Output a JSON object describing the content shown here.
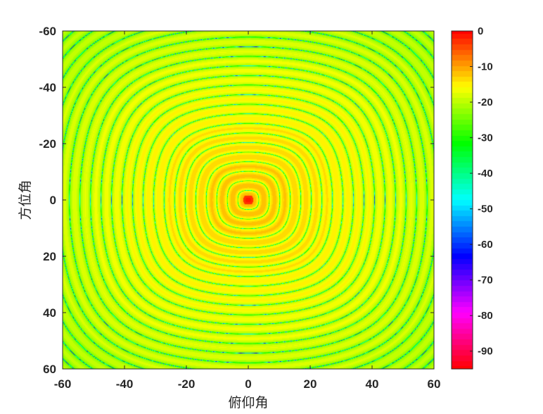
{
  "chart_data": {
    "type": "heatmap",
    "title": "",
    "xlabel": "俯仰角",
    "ylabel": "方位角",
    "x_ticks": [
      "-60",
      "-40",
      "-20",
      "0",
      "20",
      "40",
      "60"
    ],
    "y_ticks": [
      "-60",
      "-40",
      "-20",
      "0",
      "20",
      "40",
      "60"
    ],
    "xlim": [
      -60,
      60
    ],
    "ylim": [
      -60,
      60
    ],
    "y_direction": "reversed",
    "colorbar": {
      "range": [
        -95,
        0
      ],
      "ticks": [
        "0",
        "-10",
        "-20",
        "-30",
        "-40",
        "-50",
        "-60",
        "-70",
        "-80",
        "-90"
      ],
      "colormap": "hsv"
    },
    "pattern": "concentric rings centered at (0, 0); peak 0 dB at center, ring background about -15 dB, deep nulls about -40 to -50 dB on ring edges",
    "grid": false
  }
}
